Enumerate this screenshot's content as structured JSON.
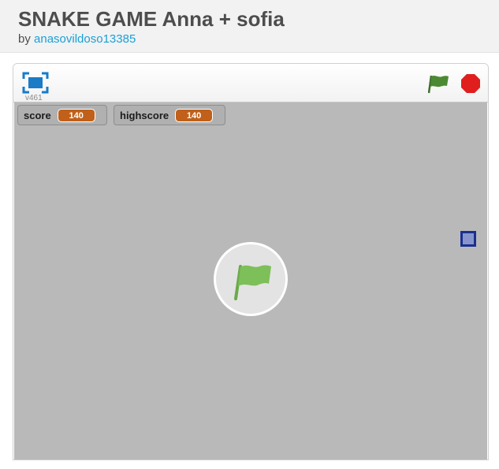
{
  "project": {
    "title": "SNAKE GAME Anna + sofia",
    "by_prefix": "by",
    "author": "anasovildoso13385"
  },
  "player": {
    "version": "v461",
    "icons": {
      "fullscreen": "fullscreen-icon",
      "green_flag": "green-flag-icon",
      "stop": "stop-sign-icon"
    },
    "colors": {
      "stage_background": "#b9b9b9",
      "flag_green": "#7dbf58",
      "stop_red": "#e01e1e",
      "variable_orange": "#c0601a"
    }
  },
  "monitors": [
    {
      "label": "score",
      "value": "140"
    },
    {
      "label": "highscore",
      "value": "140"
    }
  ]
}
